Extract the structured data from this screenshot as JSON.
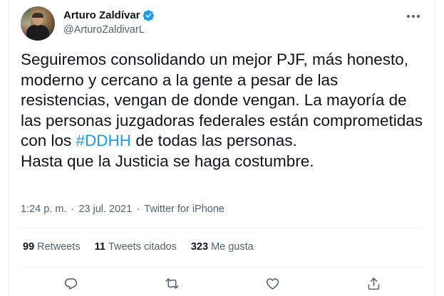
{
  "author": {
    "name": "Arturo Zaldívar",
    "handle": "@ArturoZaldivarL",
    "verified_icon": "verified-badge-icon",
    "colors": {
      "verified": "#1d9bf0"
    }
  },
  "tweet": {
    "text_before": "Seguiremos consolidando un mejor PJF, más honesto, moderno y cercano a la gente a pesar de las resistencias, vengan de donde vengan. La mayoría de las personas juzgadoras federales están comprometidas con los ",
    "hashtag": "#DDHH",
    "text_after": " de todas las personas.\nHasta que la Justicia se haga costumbre."
  },
  "meta": {
    "time": "1:24 p. m.",
    "separator": "·",
    "date": "23 jul. 2021",
    "source": "Twitter for iPhone"
  },
  "stats": {
    "retweets_count": "99",
    "retweets_label": "Retweets",
    "quotes_count": "11",
    "quotes_label": "Tweets citados",
    "likes_count": "323",
    "likes_label": "Me gusta"
  },
  "actions": [
    "reply-icon",
    "retweet-icon",
    "like-icon",
    "share-icon"
  ],
  "colors": {
    "link": "#1d9bf0",
    "secondary_text": "#536471",
    "primary_text": "#0f1419",
    "border": "#eff3f4"
  }
}
